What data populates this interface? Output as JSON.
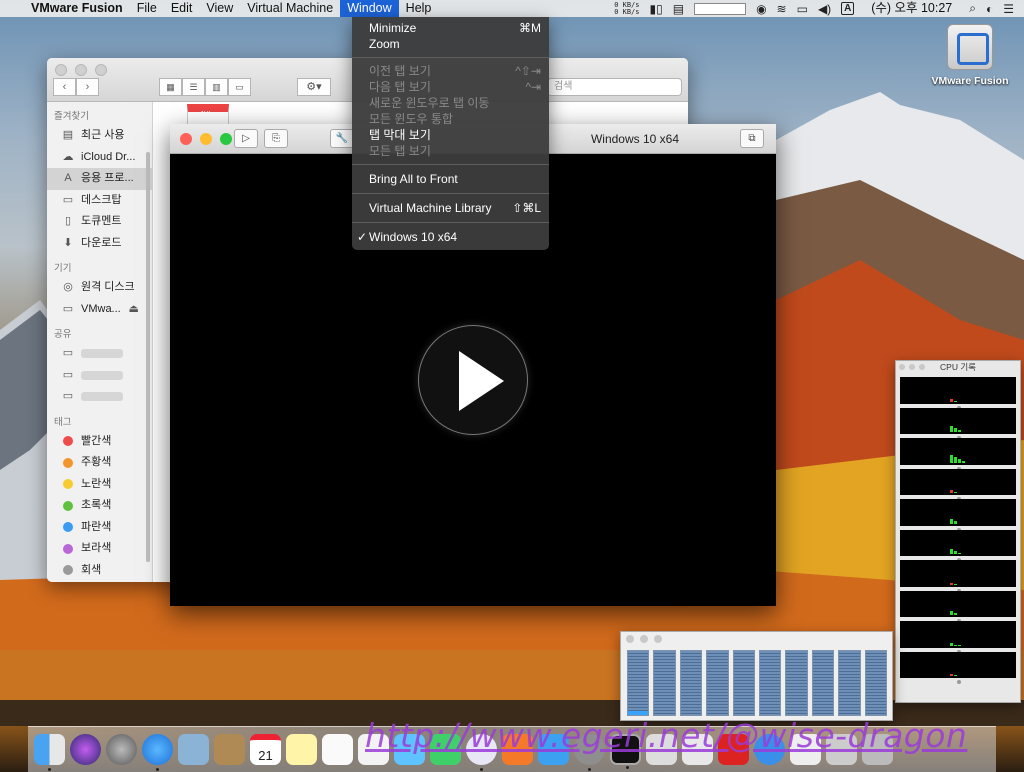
{
  "menubar": {
    "apple_icon": "apple-icon",
    "app_name": "VMware Fusion",
    "items": [
      "File",
      "Edit",
      "View",
      "Virtual Machine",
      "Window",
      "Help"
    ],
    "active_item": "Window",
    "net_up": "0 KB/s",
    "net_down": "0 KB/s",
    "input_source": "A",
    "clock": "(수) 오후 10:27"
  },
  "window_menu": {
    "minimize": {
      "label": "Minimize",
      "shortcut": "⌘M"
    },
    "zoom": {
      "label": "Zoom"
    },
    "prev_tab": {
      "label": "이전 탭 보기",
      "shortcut": "^⇧⇥"
    },
    "next_tab": {
      "label": "다음 탭 보기",
      "shortcut": "^⇥"
    },
    "move_tab": {
      "label": "새로운 윈도우로 탭 이동"
    },
    "merge_windows": {
      "label": "모든 윈도우 통합"
    },
    "tab_bar": {
      "label": "탭 막대 보기"
    },
    "all_tabs": {
      "label": "모든 탭 보기"
    },
    "bring_front": {
      "label": "Bring All to Front"
    },
    "vm_library": {
      "label": "Virtual Machine Library",
      "shortcut": "⇧⌘L"
    },
    "windows10": {
      "label": "Windows 10 x64",
      "checked": true
    }
  },
  "desktop_icon": {
    "label": "VMware Fusion"
  },
  "finder": {
    "search_placeholder": "검색",
    "section_favorites": "즐겨찾기",
    "section_devices": "기기",
    "section_shared": "공유",
    "section_tags": "태그",
    "favorites": [
      "최근 사용",
      "iCloud Dr...",
      "응용 프로...",
      "데스크탑",
      "도큐멘트",
      "다운로드"
    ],
    "devices": [
      "원격 디스크",
      "VMwa..."
    ],
    "shared": [
      "",
      "",
      ""
    ],
    "tags": [
      {
        "label": "빨간색",
        "color": "#f04b4b"
      },
      {
        "label": "주황색",
        "color": "#f3952b"
      },
      {
        "label": "노란색",
        "color": "#f4cc32"
      },
      {
        "label": "초록색",
        "color": "#5fc13e"
      },
      {
        "label": "파란색",
        "color": "#3b9af2"
      },
      {
        "label": "보라색",
        "color": "#b866d8"
      },
      {
        "label": "회색",
        "color": "#9a9a9a"
      }
    ],
    "calendar_icon_month": "JUL"
  },
  "vm_window": {
    "title": "Windows 10 x64",
    "play_icon": "play-icon"
  },
  "cpu_history": {
    "title": "CPU 기록"
  },
  "dock": {
    "calendar_day": "21"
  },
  "watermark": "http://www.egeri.net/@wise-dragon"
}
